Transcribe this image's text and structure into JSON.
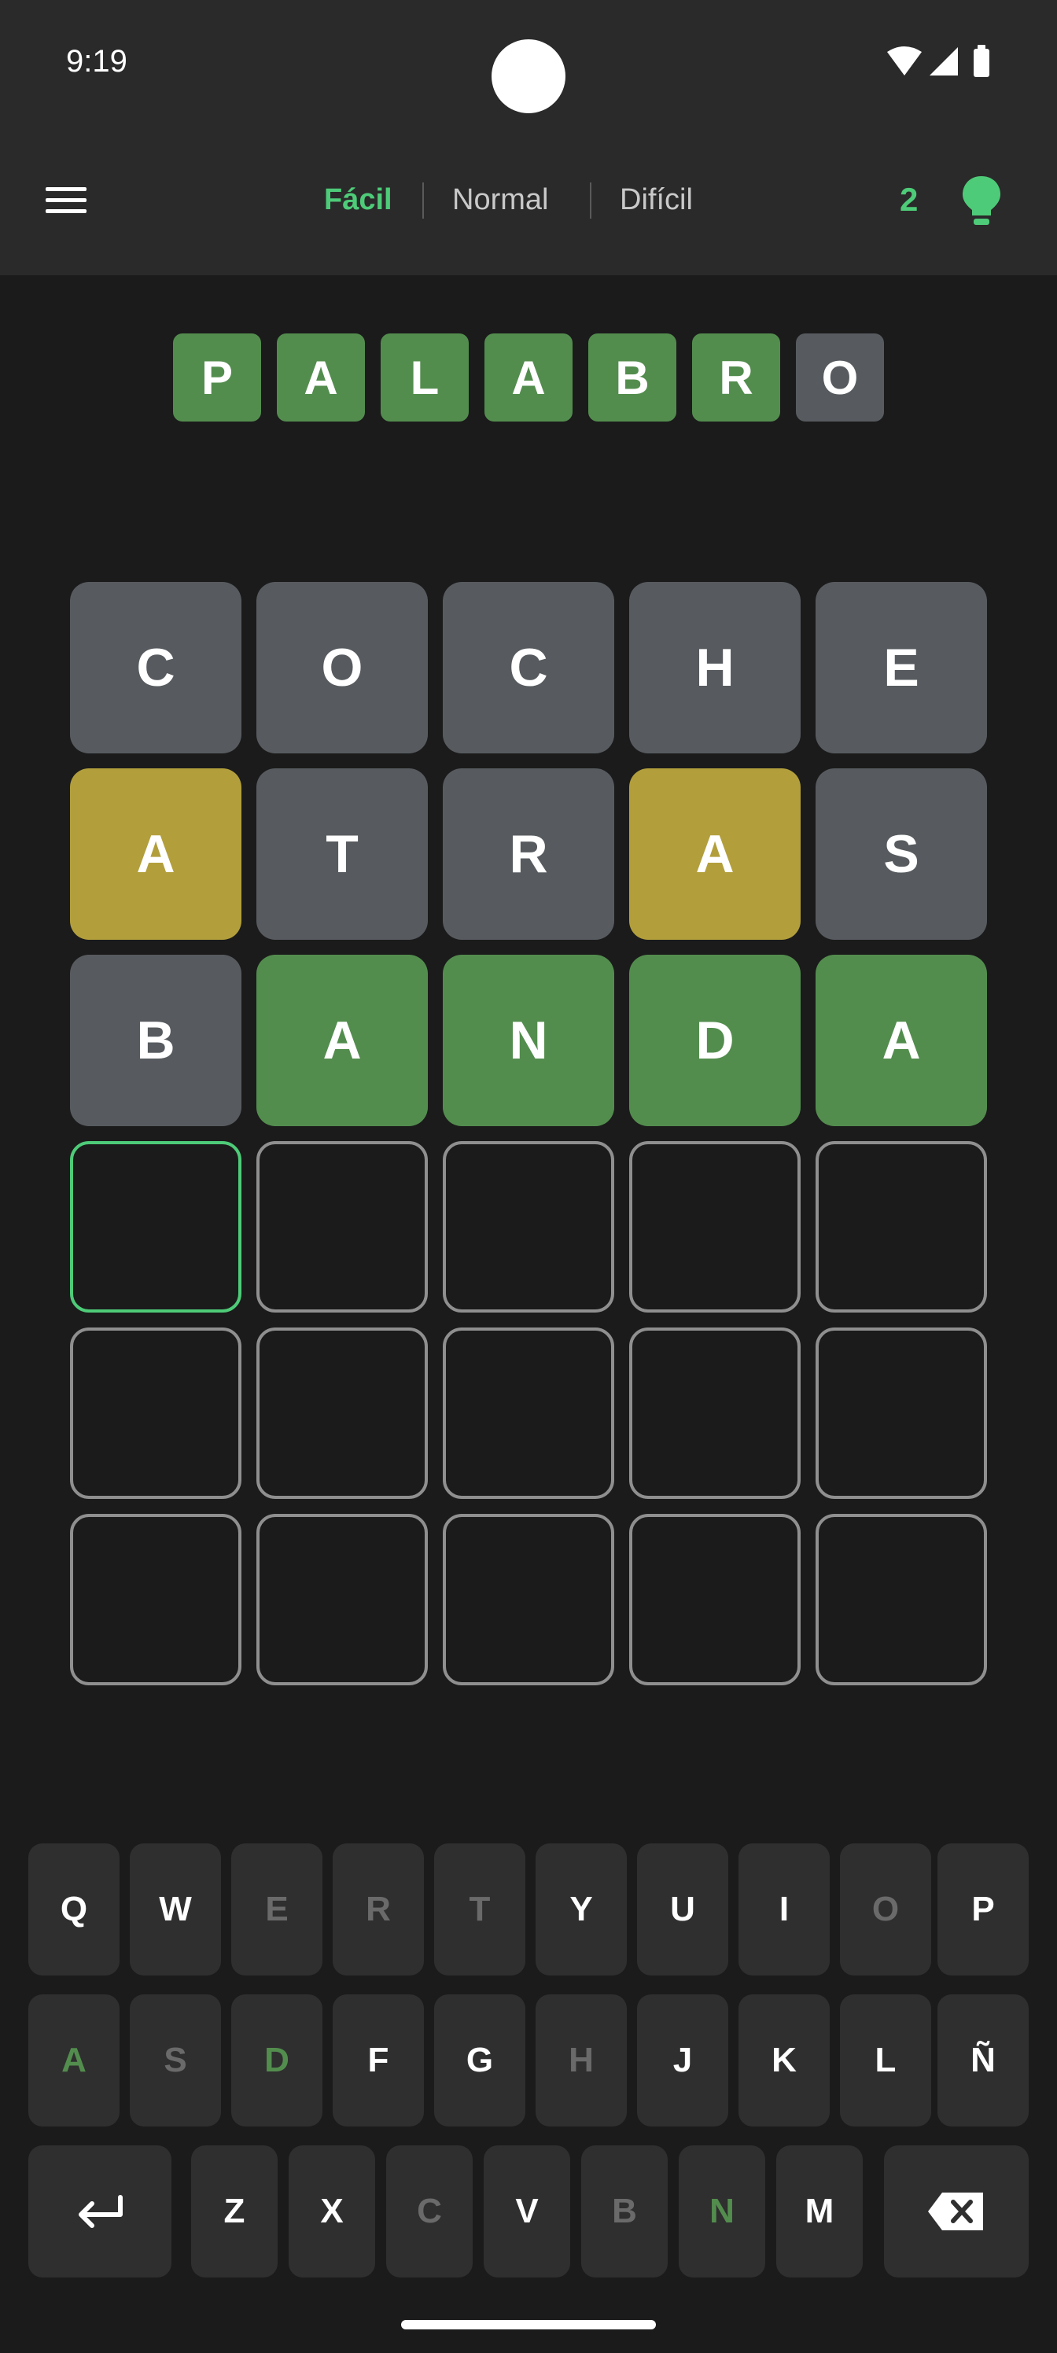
{
  "status": {
    "time": "9:19"
  },
  "header": {
    "modes": [
      {
        "label": "Fácil",
        "active": true
      },
      {
        "label": "Normal",
        "active": false
      },
      {
        "label": "Difícil",
        "active": false
      }
    ],
    "hints_count": "2"
  },
  "word": [
    {
      "letter": "P",
      "state": "green"
    },
    {
      "letter": "A",
      "state": "green"
    },
    {
      "letter": "L",
      "state": "green"
    },
    {
      "letter": "A",
      "state": "green"
    },
    {
      "letter": "B",
      "state": "green"
    },
    {
      "letter": "R",
      "state": "green"
    },
    {
      "letter": "O",
      "state": "gray"
    }
  ],
  "grid": [
    [
      {
        "letter": "C",
        "state": "gray"
      },
      {
        "letter": "O",
        "state": "gray"
      },
      {
        "letter": "C",
        "state": "gray"
      },
      {
        "letter": "H",
        "state": "gray"
      },
      {
        "letter": "E",
        "state": "gray"
      }
    ],
    [
      {
        "letter": "A",
        "state": "yellow"
      },
      {
        "letter": "T",
        "state": "gray"
      },
      {
        "letter": "R",
        "state": "gray"
      },
      {
        "letter": "A",
        "state": "yellow"
      },
      {
        "letter": "S",
        "state": "gray"
      }
    ],
    [
      {
        "letter": "B",
        "state": "gray"
      },
      {
        "letter": "A",
        "state": "green"
      },
      {
        "letter": "N",
        "state": "green"
      },
      {
        "letter": "D",
        "state": "green"
      },
      {
        "letter": "A",
        "state": "green"
      }
    ],
    [
      {
        "letter": "",
        "state": "active"
      },
      {
        "letter": "",
        "state": "empty"
      },
      {
        "letter": "",
        "state": "empty"
      },
      {
        "letter": "",
        "state": "empty"
      },
      {
        "letter": "",
        "state": "empty"
      }
    ],
    [
      {
        "letter": "",
        "state": "empty"
      },
      {
        "letter": "",
        "state": "empty"
      },
      {
        "letter": "",
        "state": "empty"
      },
      {
        "letter": "",
        "state": "empty"
      },
      {
        "letter": "",
        "state": "empty"
      }
    ],
    [
      {
        "letter": "",
        "state": "empty"
      },
      {
        "letter": "",
        "state": "empty"
      },
      {
        "letter": "",
        "state": "empty"
      },
      {
        "letter": "",
        "state": "empty"
      },
      {
        "letter": "",
        "state": "empty"
      }
    ]
  ],
  "keyboard": {
    "row1": [
      {
        "label": "Q",
        "state": "normal"
      },
      {
        "label": "W",
        "state": "normal"
      },
      {
        "label": "E",
        "state": "absent"
      },
      {
        "label": "R",
        "state": "absent"
      },
      {
        "label": "T",
        "state": "absent"
      },
      {
        "label": "Y",
        "state": "normal"
      },
      {
        "label": "U",
        "state": "normal"
      },
      {
        "label": "I",
        "state": "normal"
      },
      {
        "label": "O",
        "state": "absent"
      },
      {
        "label": "P",
        "state": "normal"
      }
    ],
    "row2": [
      {
        "label": "A",
        "state": "present"
      },
      {
        "label": "S",
        "state": "absent"
      },
      {
        "label": "D",
        "state": "present"
      },
      {
        "label": "F",
        "state": "normal"
      },
      {
        "label": "G",
        "state": "normal"
      },
      {
        "label": "H",
        "state": "absent"
      },
      {
        "label": "J",
        "state": "normal"
      },
      {
        "label": "K",
        "state": "normal"
      },
      {
        "label": "L",
        "state": "normal"
      },
      {
        "label": "Ñ",
        "state": "normal"
      }
    ],
    "row3": [
      {
        "label": "Z",
        "state": "normal"
      },
      {
        "label": "X",
        "state": "normal"
      },
      {
        "label": "C",
        "state": "absent"
      },
      {
        "label": "V",
        "state": "normal"
      },
      {
        "label": "B",
        "state": "absent"
      },
      {
        "label": "N",
        "state": "present"
      },
      {
        "label": "M",
        "state": "normal"
      }
    ],
    "enter_icon": "enter-icon",
    "backspace_icon": "backspace-icon"
  },
  "colors": {
    "accent": "#4ecb78",
    "correct": "#538d4e",
    "present": "#b29f3c",
    "absent": "#575b5f"
  }
}
